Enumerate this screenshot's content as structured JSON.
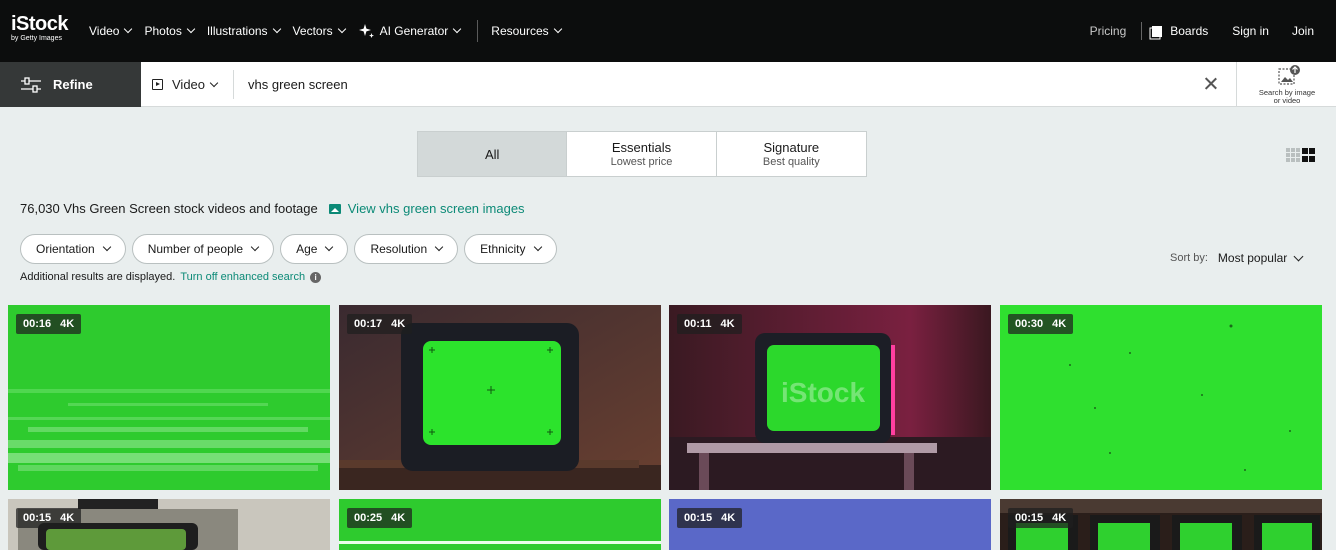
{
  "nav": {
    "logo": "iStock",
    "logo_sub": "by Getty Images",
    "links": [
      {
        "label": "Video"
      },
      {
        "label": "Photos"
      },
      {
        "label": "Illustrations"
      },
      {
        "label": "Vectors"
      },
      {
        "label": "AI Generator"
      },
      {
        "label": "Resources"
      }
    ],
    "pricing": "Pricing",
    "boards": "Boards",
    "sign_in": "Sign in",
    "join": "Join"
  },
  "search": {
    "refine_label": "Refine",
    "media_type": "Video",
    "query": "vhs green screen",
    "search_by_image": "Search by image or video"
  },
  "tabs": [
    {
      "title": "All",
      "subtitle": ""
    },
    {
      "title": "Essentials",
      "subtitle": "Lowest price"
    },
    {
      "title": "Signature",
      "subtitle": "Best quality"
    }
  ],
  "results": {
    "count_text": "76,030 Vhs Green Screen stock videos and footage",
    "view_images_link": "View vhs green screen images"
  },
  "filters": [
    "Orientation",
    "Number of people",
    "Age",
    "Resolution",
    "Ethnicity"
  ],
  "enhanced": {
    "text": "Additional results are displayed.",
    "link": "Turn off enhanced search",
    "info": "i"
  },
  "sort": {
    "label": "Sort by:",
    "value": "Most popular"
  },
  "thumbnails": [
    {
      "duration": "00:16",
      "quality": "4K"
    },
    {
      "duration": "00:17",
      "quality": "4K"
    },
    {
      "duration": "00:11",
      "quality": "4K"
    },
    {
      "duration": "00:30",
      "quality": "4K"
    },
    {
      "duration": "00:15",
      "quality": "4K"
    },
    {
      "duration": "00:25",
      "quality": "4K"
    },
    {
      "duration": "00:15",
      "quality": "4K"
    },
    {
      "duration": "00:15",
      "quality": "4K"
    }
  ],
  "colors": {
    "accent": "#0c8a77",
    "chroma_green": "#2ece2e",
    "nav_bg": "#0c0d0d"
  }
}
